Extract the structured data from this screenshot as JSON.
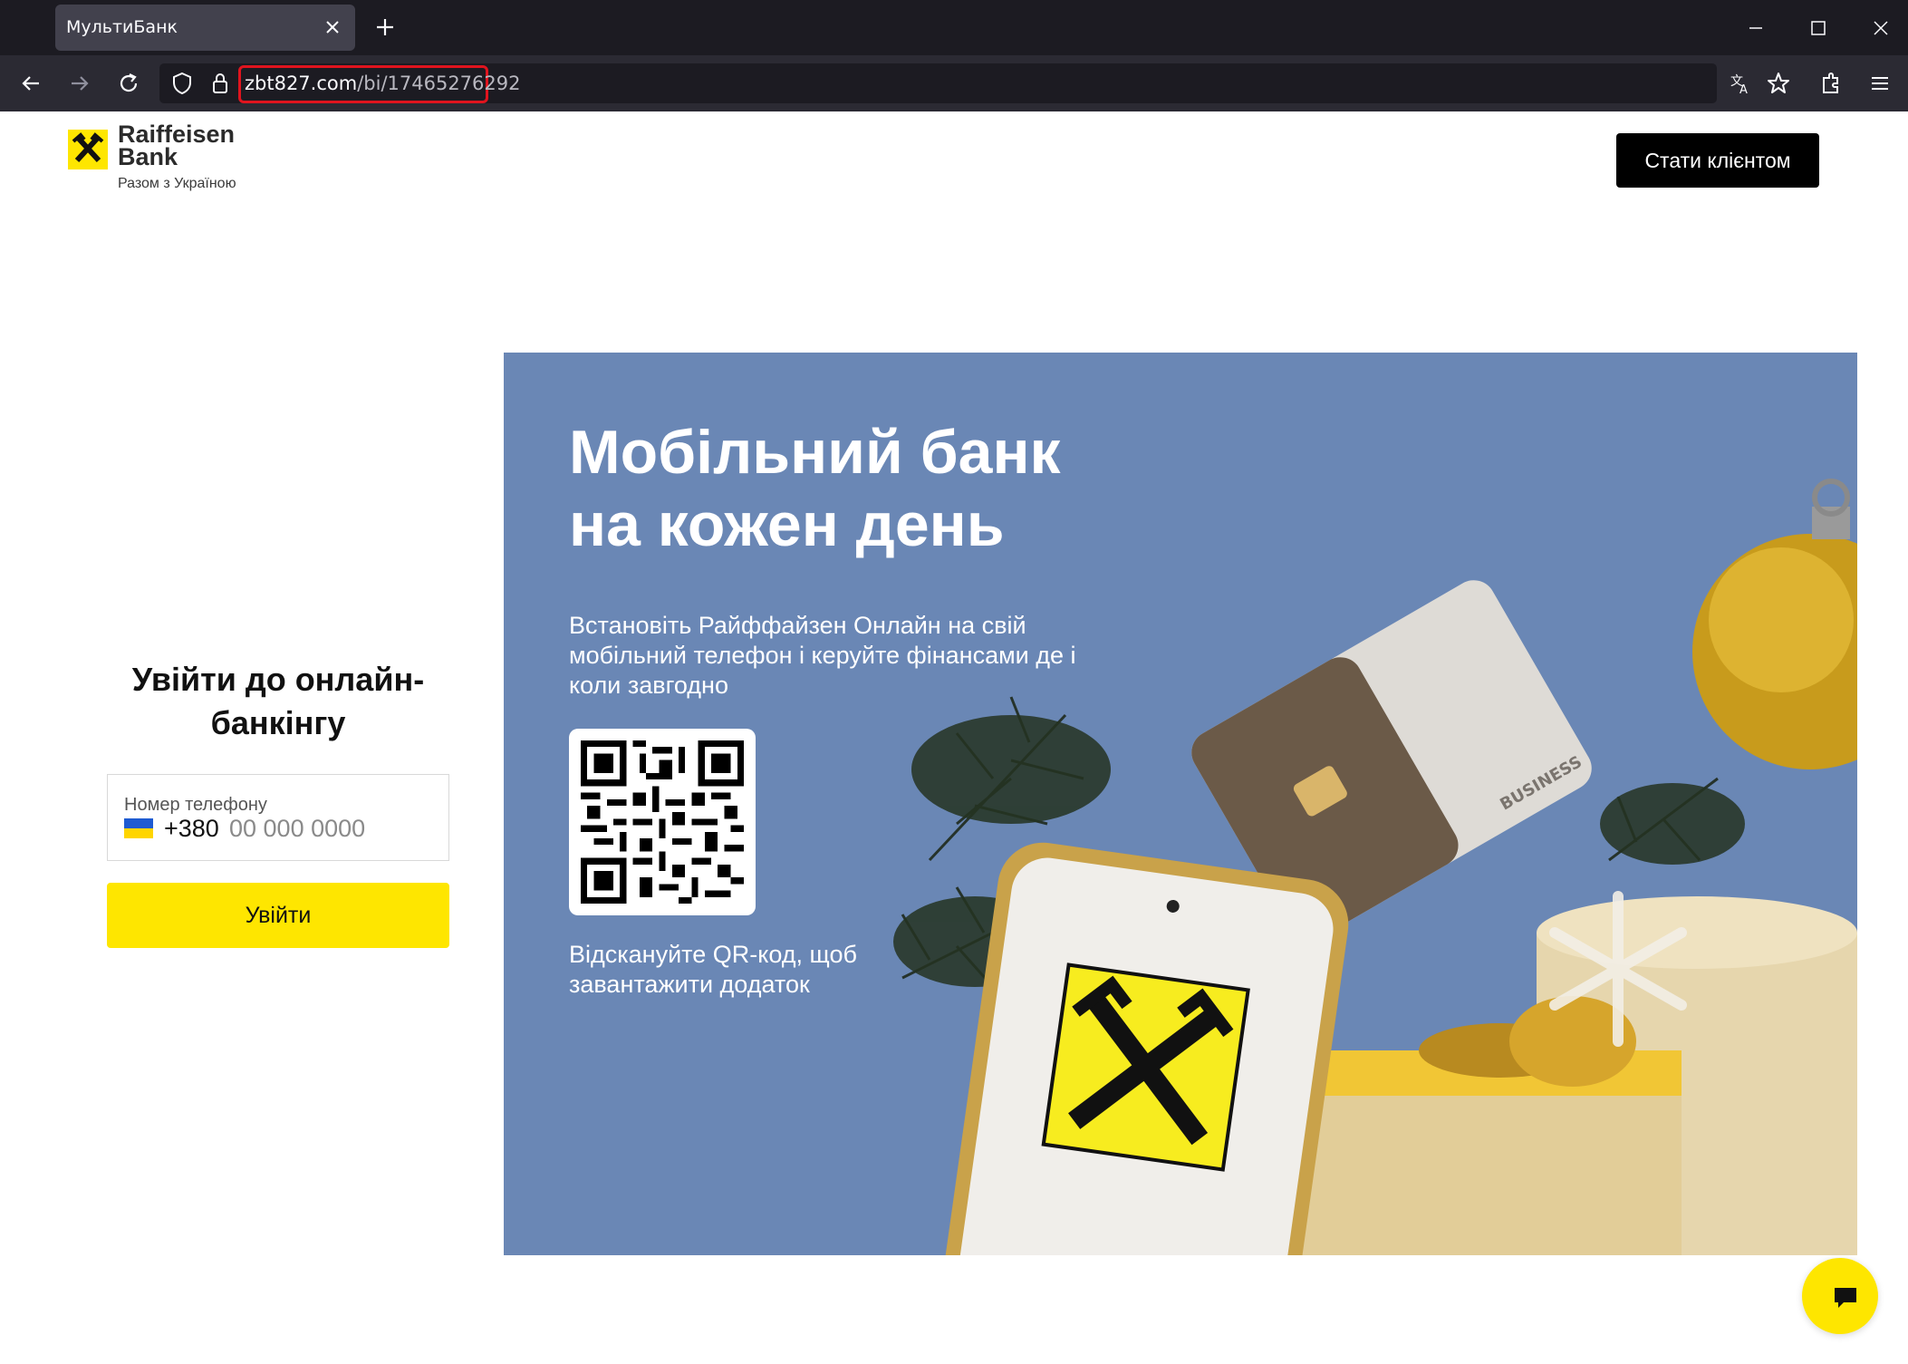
{
  "browser": {
    "tab_title": "МультиБанк",
    "url_domain": "zbt827.com",
    "url_path": "/bi/17465276292"
  },
  "header": {
    "logo_name_line1": "Raiffeisen",
    "logo_name_line2": "Bank",
    "logo_tagline": "Разом з Україною",
    "cta_label": "Стати клієнтом"
  },
  "login": {
    "title": "Увійти до онлайн-банкінгу",
    "phone_label": "Номер телефону",
    "country_code": "+380",
    "phone_placeholder": "00 000 0000",
    "submit_label": "Увійти"
  },
  "banner": {
    "title_line1": "Мобільний банк",
    "title_line2": "на кожен день",
    "subtitle": "Встановіть Райффайзен Онлайн на свій мобільний телефон і керуйте фінансами де і коли завгодно",
    "qr_caption": "Відскануйте QR-код, щоб завантажити додаток",
    "card_text": "BUSINESS"
  },
  "colors": {
    "brand_yellow": "#fee600",
    "banner_blue": "#6a87b5",
    "url_highlight": "#e0141e"
  }
}
